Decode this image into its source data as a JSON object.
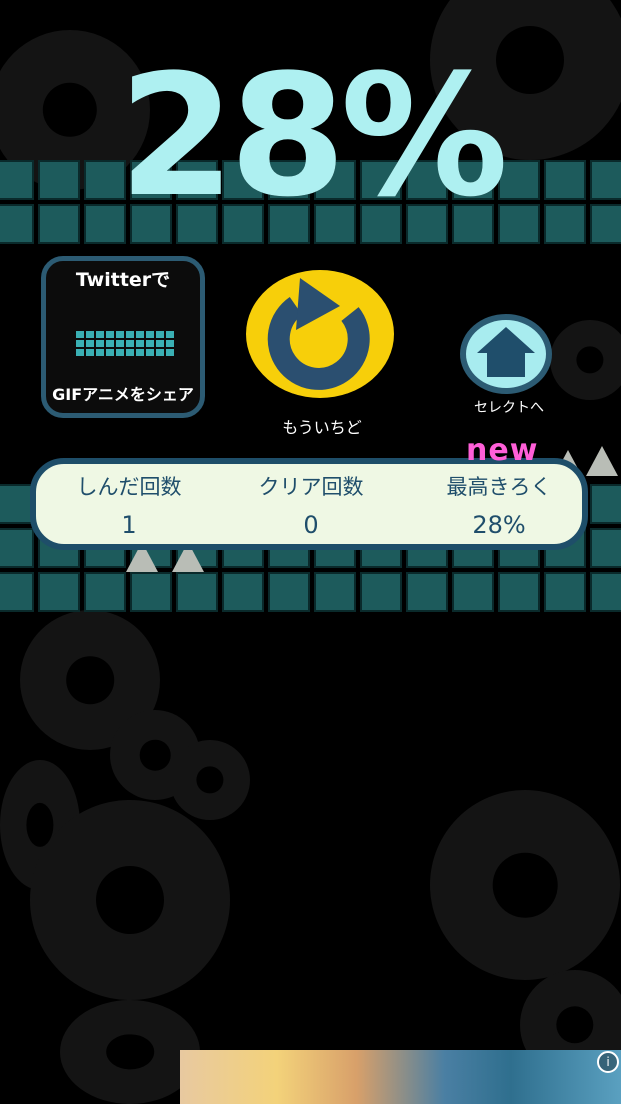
{
  "result": {
    "percent_text": "28%"
  },
  "share": {
    "top_label": "Twitterで",
    "bottom_label": "GIFアニメをシェア"
  },
  "retry": {
    "label": "もういちど"
  },
  "select": {
    "label": "セレクトへ"
  },
  "stats": {
    "new_badge": "new",
    "columns": [
      {
        "title": "しんだ回数",
        "value": "1"
      },
      {
        "title": "クリア回数",
        "value": "0"
      },
      {
        "title": "最高きろく",
        "value": "28%"
      }
    ]
  },
  "colors": {
    "percent_text": "#aef0f1",
    "tile": "#1d5b5c",
    "panel_border": "#1e4e69",
    "panel_fill": "#eff8e4",
    "retry_yellow": "#f7cf0a",
    "new_badge": "#ff5fd8"
  },
  "icons": {
    "retry": "circular-arrow-icon",
    "select": "home-icon",
    "ad_info": "info-icon"
  },
  "ad": {
    "info_symbol": "i"
  }
}
